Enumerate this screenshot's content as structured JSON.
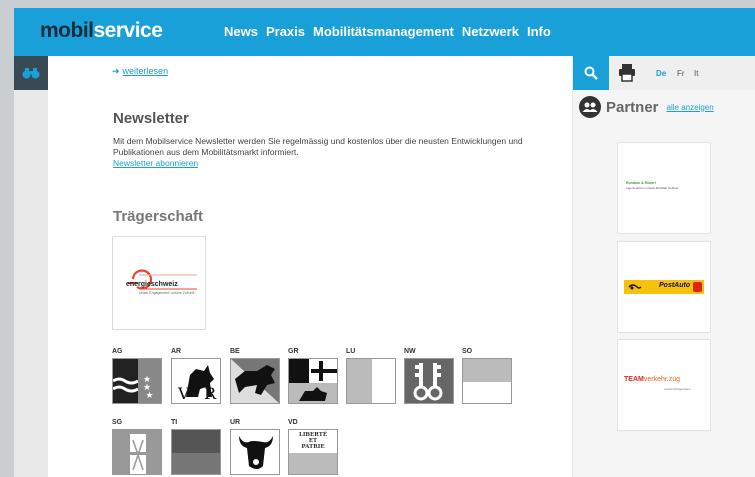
{
  "header": {
    "logo_main": "mobil",
    "logo_second": "service",
    "nav": [
      "News",
      "Praxis",
      "Mobilitätsmanagement",
      "Netzwerk",
      "Info"
    ]
  },
  "main": {
    "readmore": "weiterlesen",
    "newsletter": {
      "title": "Newsletter",
      "text": "Mit dem Mobilservice Newsletter werden Sie regelmässig und kostenlos über die neusten Entwicklungen und Publikationen aus dem Mobilitätsmarkt informiert.",
      "link": "Newsletter abonnieren"
    },
    "traegerschaft": {
      "title": "Trägerschaft",
      "logo_text": "energieschweiz",
      "logo_sub": "Unser Engagement: unsere Zukunft.",
      "cantons": [
        "AG",
        "AR",
        "BE",
        "GR",
        "LU",
        "NW",
        "SO",
        "SG",
        "TI",
        "UR",
        "VD"
      ],
      "vd_motto_1": "LIBERTÉ",
      "vd_motto_2": "ET",
      "vd_motto_3": "PATRIE"
    }
  },
  "sidebar": {
    "languages": [
      "De",
      "Fr",
      "It"
    ],
    "active_language": "De",
    "partner_title": "Partner",
    "partner_link": "alle anzeigen",
    "partners": [
      {
        "line1": "Rundum & Rüberl",
        "line2": "Ingenieurbüro umwelt-Mobilität Gebiete"
      },
      {
        "text": "PostAuto"
      },
      {
        "text_a": "TEAM",
        "text_b": "verkehr.zug",
        "sub": "verkehrsfragenteam"
      }
    ]
  },
  "colors": {
    "accent": "#1aa0d8",
    "dark": "#1a2d3b",
    "postauto": "#f7c20e",
    "team_red": "#e2231a"
  }
}
